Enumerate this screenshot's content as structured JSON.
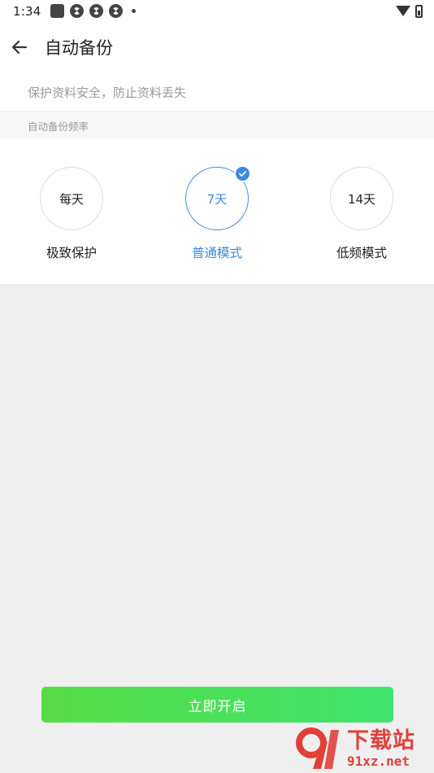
{
  "status_bar": {
    "time": "1:34",
    "icons": [
      "square-icon",
      "pinwheel-icon",
      "pinwheel-icon",
      "pinwheel-icon",
      "dot-icon",
      "wifi-icon",
      "battery-icon"
    ]
  },
  "header": {
    "back_icon": "arrow-left-icon",
    "title": "自动备份"
  },
  "subtitle": "保护资料安全，防止资料丢失",
  "section_label": "自动备份频率",
  "options": [
    {
      "circle_text": "每天",
      "label": "极致保护",
      "selected": false
    },
    {
      "circle_text": "7天",
      "label": "普通模式",
      "selected": true
    },
    {
      "circle_text": "14天",
      "label": "低频模式",
      "selected": false
    }
  ],
  "start_button_label": "立即开启",
  "colors": {
    "accent_blue": "#3d8ae0",
    "button_green_start": "#56dc45",
    "button_green_end": "#3fe46d",
    "watermark_red": "#e0403a"
  },
  "watermark": {
    "logo_text": "91",
    "name": "下载站",
    "url": "91xz.net"
  }
}
